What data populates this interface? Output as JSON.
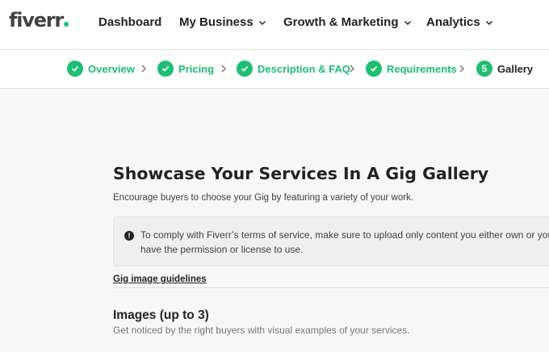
{
  "nav": {
    "logo": "fiverr",
    "items": [
      {
        "label": "Dashboard",
        "has_dropdown": false
      },
      {
        "label": "My Business",
        "has_dropdown": true
      },
      {
        "label": "Growth & Marketing",
        "has_dropdown": true
      },
      {
        "label": "Analytics",
        "has_dropdown": true
      }
    ]
  },
  "steps": [
    {
      "label": "Overview",
      "status": "complete"
    },
    {
      "label": "Pricing",
      "status": "complete"
    },
    {
      "label": "Description & FAQ",
      "status": "complete"
    },
    {
      "label": "Requirements",
      "status": "complete"
    },
    {
      "label": "Gallery",
      "status": "current",
      "number": "5"
    }
  ],
  "page": {
    "title": "Showcase Your Services In A Gig Gallery",
    "subtitle": "Encourage buyers to choose your Gig by featuring a variety of your work.",
    "notice": "To comply with Fiverr’s terms of service, make sure to upload only content you either own or you have the permission or license to use.",
    "guidelines_link": "Gig image guidelines",
    "images_section": {
      "title": "Images (up to 3)",
      "subtitle": "Get noticed by the right buyers with visual examples of your services."
    }
  },
  "colors": {
    "accent": "#1dbf73",
    "text": "#222325",
    "muted": "#74767e",
    "background": "#f7f7f7"
  }
}
